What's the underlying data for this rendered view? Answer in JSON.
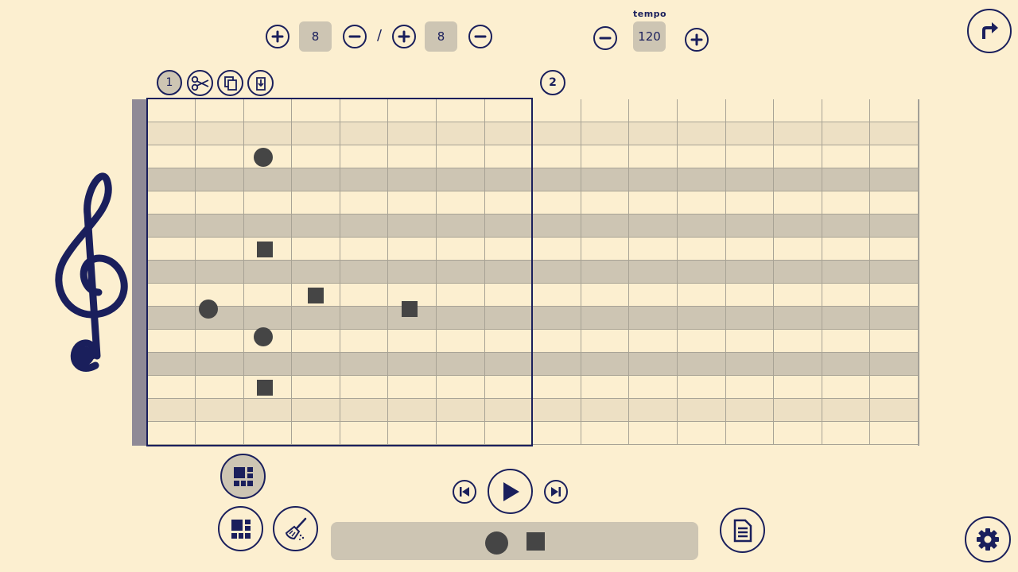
{
  "time_signature": {
    "numerator": "8",
    "separator": "/",
    "denominator": "8"
  },
  "tempo": {
    "label": "tempo",
    "value": "120"
  },
  "measures": [
    {
      "number": "1"
    },
    {
      "number": "2"
    }
  ],
  "colors": {
    "ink": "#1a1f5c",
    "background": "#fcefd0",
    "band_light": "#ede0c4",
    "band_dark": "#cdc5b3",
    "note": "#454545"
  },
  "toolbar_icons": [
    "scissors-icon",
    "copy-icon",
    "paste-icon"
  ],
  "staff": {
    "columns": 16,
    "rows": 15,
    "row_shading": [
      "none",
      "light",
      "none",
      "dark",
      "none",
      "dark",
      "none",
      "dark",
      "none",
      "dark",
      "none",
      "dark",
      "none",
      "light",
      "none"
    ],
    "notes": [
      {
        "shape": "circle",
        "beat": 3,
        "row": 2
      },
      {
        "shape": "square",
        "beat": 3,
        "row": 6
      },
      {
        "shape": "square",
        "beat": 4,
        "row": 8
      },
      {
        "shape": "circle",
        "beat": 2,
        "row": 9
      },
      {
        "shape": "square",
        "beat": 6,
        "row": 9
      },
      {
        "shape": "circle",
        "beat": 3,
        "row": 10
      },
      {
        "shape": "square",
        "beat": 3,
        "row": 12
      }
    ]
  },
  "palette": [
    "circle-note",
    "square-note"
  ]
}
